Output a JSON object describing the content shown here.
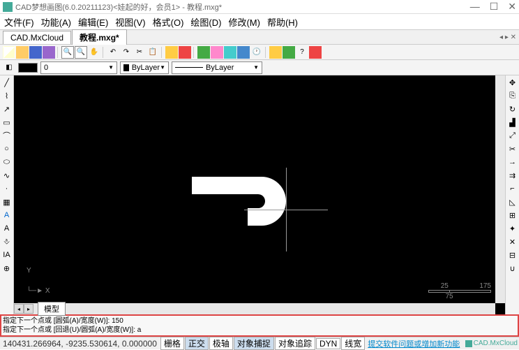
{
  "titlebar": {
    "title": "CAD梦想画图(6.0.20211123)<娃起的好，会员1> - 教程.mxg*",
    "min": "—",
    "max": "☐",
    "close": "✕"
  },
  "menu": {
    "file": "文件(F)",
    "func": "功能(A)",
    "edit": "编辑(E)",
    "view": "视图(V)",
    "format": "格式(O)",
    "draw": "绘图(D)",
    "modify": "修改(M)",
    "help": "帮助(H)"
  },
  "tabs": {
    "cloud": "CAD.MxCloud",
    "tutorial": "教程.mxg*",
    "close": "◂ ▸ ✕"
  },
  "layer": {
    "value": "0",
    "bylayer": "ByLayer",
    "linetype": "ByLayer"
  },
  "modeltab": "模型",
  "ucs": {
    "y": "Y",
    "x": "X"
  },
  "scale": {
    "t1": "25",
    "t2": "175",
    "t3": "75"
  },
  "cmd": {
    "line1": "指定下一个点或 [圆弧(A)/宽度(W)]: 150",
    "line2": "指定下一个点或 [回退(U)/圆弧(A)/宽度(W)]: a"
  },
  "status": {
    "coords": "140431.266964, -9235.530614, 0.000000",
    "grid": "栅格",
    "ortho": "正交",
    "polar": "极轴",
    "osnap": "对象捕捉",
    "otrack": "对象追踪",
    "dyn": "DYN",
    "lwt": "线宽",
    "feedback": "提交软件问题或增加新功能",
    "brand": "CAD.MxCloud"
  }
}
